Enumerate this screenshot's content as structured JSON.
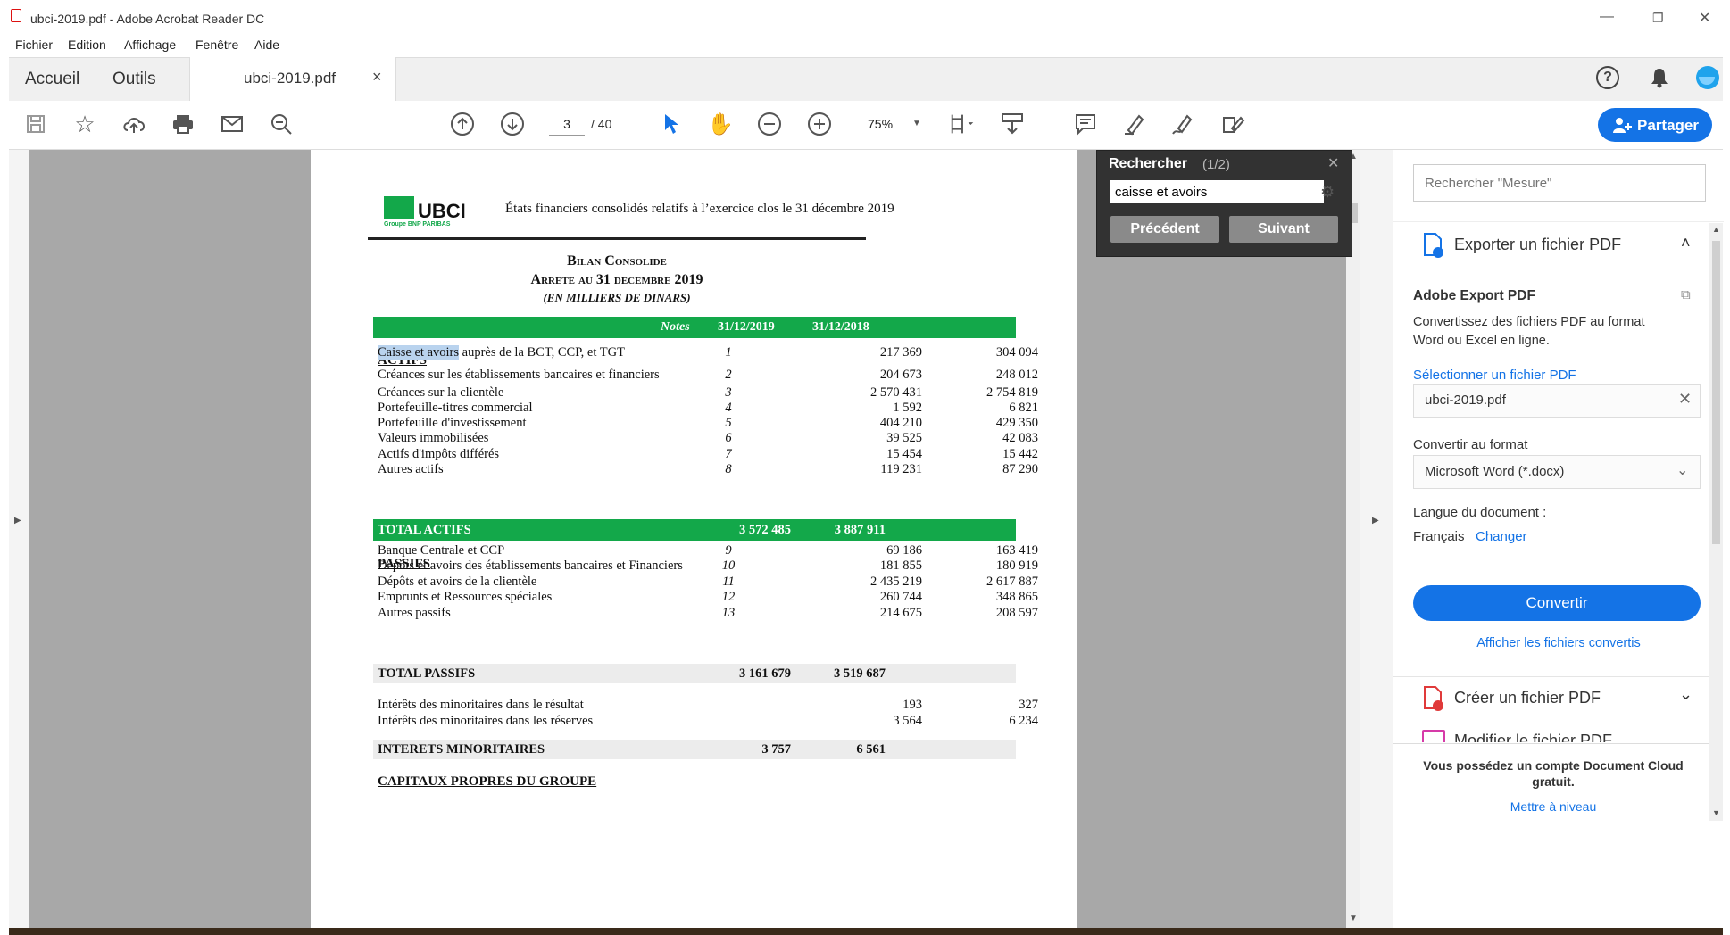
{
  "window": {
    "title": "ubci-2019.pdf - Adobe Acrobat Reader DC",
    "menu": [
      "Fichier",
      "Edition",
      "Affichage",
      "Fenêtre",
      "Aide"
    ]
  },
  "tabs": {
    "home": "Accueil",
    "tools": "Outils",
    "document": "ubci-2019.pdf",
    "close": "×"
  },
  "header_icons": [
    "help-icon",
    "bell-icon",
    "account-icon"
  ],
  "toolbar": {
    "page_current": "3",
    "page_total": "/ 40",
    "zoom": "75%",
    "share_label": "Partager"
  },
  "search": {
    "title": "Rechercher",
    "count": "(1/2)",
    "query": "caisse et avoirs",
    "prev": "Précédent",
    "next": "Suivant"
  },
  "right_panel": {
    "search_placeholder": "Rechercher \"Mesure\"",
    "export_title": "Exporter un fichier PDF",
    "service_title": "Adobe Export PDF",
    "service_desc_1": "Convertissez des fichiers PDF au format",
    "service_desc_2": "Word ou Excel en ligne.",
    "select_file": "Sélectionner un fichier PDF",
    "file_name": "ubci-2019.pdf",
    "convert_to_label": "Convertir au format",
    "format": "Microsoft Word (*.docx)",
    "lang_label": "Langue du document :",
    "lang_value": "Français",
    "lang_change": "Changer",
    "convert_button": "Convertir",
    "view_converted": "Afficher les fichiers convertis",
    "create_title": "Créer un fichier PDF",
    "edit_title": "Modifier le fichier PDF",
    "cloud_msg_1": "Vous possédez un compte Document Cloud",
    "cloud_msg_2": "gratuit.",
    "upgrade": "Mettre à niveau"
  },
  "document": {
    "logo_text": "UBCI",
    "logo_sub": "Groupe BNP PARIBAS",
    "header": "États financiers consolidés relatifs à l’exercice clos le 31 décembre 2019",
    "title_1": "Bilan Consolide",
    "title_2": "Arrete au 31 decembre 2019",
    "title_3": "(EN MILLIERS DE DINARS)",
    "col_notes": "Notes",
    "col_2019": "31/12/2019",
    "col_2018": "31/12/2018",
    "actifs_heading": "ACTIFS",
    "actifs": [
      {
        "label_hl": "Caisse et avoirs",
        "label": " auprès de la BCT, CCP, et TGT",
        "note": "1",
        "v2019": "217 369",
        "v2018": "304 094"
      },
      {
        "label_hl": "",
        "label": "Créances sur les établissements bancaires et financiers",
        "note": "2",
        "v2019": "204 673",
        "v2018": "248 012"
      },
      {
        "label_hl": "",
        "label": "Créances sur la clientèle",
        "note": "3",
        "v2019": "2 570 431",
        "v2018": "2 754 819"
      },
      {
        "label_hl": "",
        "label": "Portefeuille-titres commercial",
        "note": "4",
        "v2019": "1 592",
        "v2018": "6 821"
      },
      {
        "label_hl": "",
        "label": "Portefeuille d'investissement",
        "note": "5",
        "v2019": "404 210",
        "v2018": "429 350"
      },
      {
        "label_hl": "",
        "label": "Valeurs immobilisées",
        "note": "6",
        "v2019": "39 525",
        "v2018": "42 083"
      },
      {
        "label_hl": "",
        "label": "Actifs d'impôts différés",
        "note": "7",
        "v2019": "15 454",
        "v2018": "15 442"
      },
      {
        "label_hl": "",
        "label": "Autres actifs",
        "note": "8",
        "v2019": "119 231",
        "v2018": "87 290"
      }
    ],
    "total_actifs": {
      "label": "TOTAL ACTIFS",
      "v2019": "3 572 485",
      "v2018": "3 887 911"
    },
    "passifs_heading": "PASSIFS",
    "passifs": [
      {
        "label": "Banque Centrale et CCP",
        "note": "9",
        "v2019": "69 186",
        "v2018": "163 419"
      },
      {
        "label": "Dépôts et avoirs des établissements bancaires et Financiers",
        "note": "10",
        "v2019": "181 855",
        "v2018": "180 919"
      },
      {
        "label": "Dépôts et avoirs de la clientèle",
        "note": "11",
        "v2019": "2 435 219",
        "v2018": "2 617 887"
      },
      {
        "label": "Emprunts et Ressources spéciales",
        "note": "12",
        "v2019": "260 744",
        "v2018": "348 865"
      },
      {
        "label": "Autres passifs",
        "note": "13",
        "v2019": "214 675",
        "v2018": "208 597"
      }
    ],
    "total_passifs": {
      "label": "TOTAL PASSIFS",
      "v2019": "3 161 679",
      "v2018": "3 519 687"
    },
    "minoritaires": [
      {
        "label": "Intérêts des minoritaires dans le résultat",
        "v2019": "193",
        "v2018": "327"
      },
      {
        "label": "Intérêts des minoritaires dans les réserves",
        "v2019": "3 564",
        "v2018": "6 234"
      }
    ],
    "total_minoritaires": {
      "label": "INTERETS MINORITAIRES",
      "v2019": "3 757",
      "v2018": "6 561"
    },
    "cut_heading": "CAPITAUX PROPRES DU GROUPE"
  },
  "colors": {
    "accent": "#1473e6",
    "green": "#13a84a",
    "search_bg": "#323232"
  }
}
